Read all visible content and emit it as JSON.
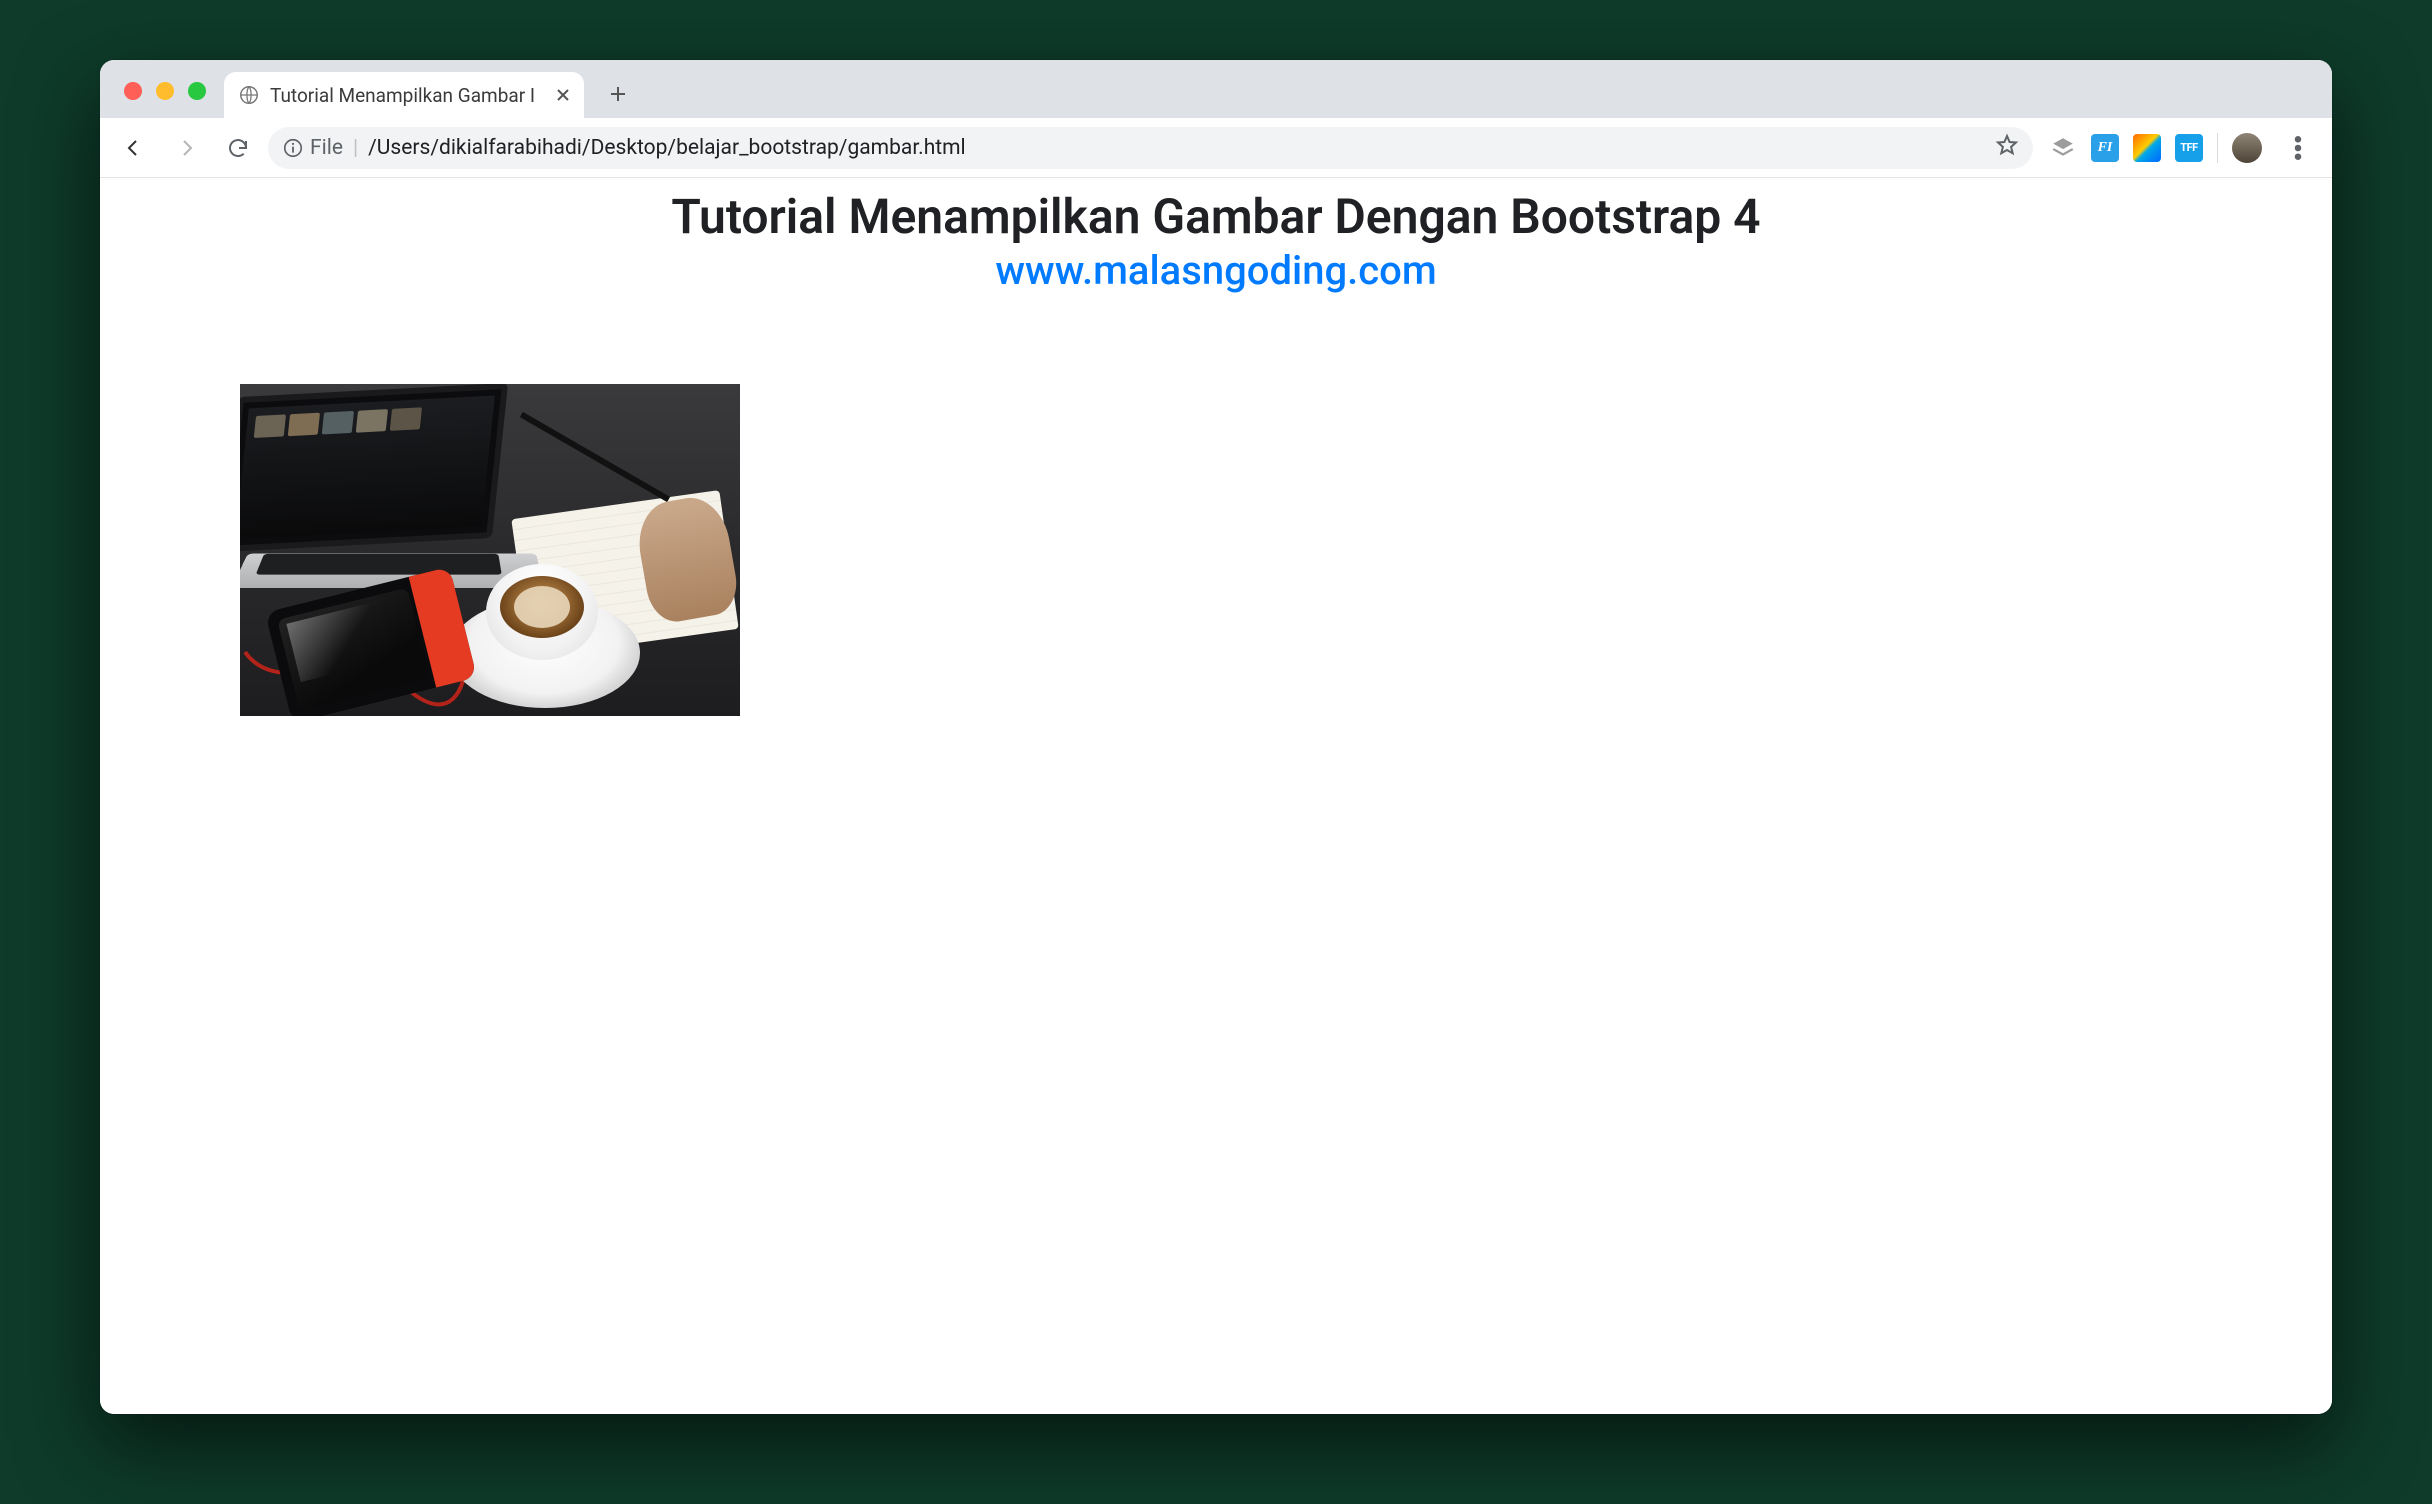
{
  "browser": {
    "tab_title": "Tutorial Menampilkan Gambar I",
    "omnibox": {
      "scheme_label": "File",
      "path": "/Users/dikialfarabihadi/Desktop/belajar_bootstrap/gambar.html"
    }
  },
  "extensions": {
    "f1_label": "FI",
    "tff_label": "TFF"
  },
  "page": {
    "heading": "Tutorial Menampilkan Gambar Dengan Bootstrap 4",
    "subheading": "www.malasngoding.com",
    "image_alt": "desk-workspace-coffee-laptop-photo"
  }
}
